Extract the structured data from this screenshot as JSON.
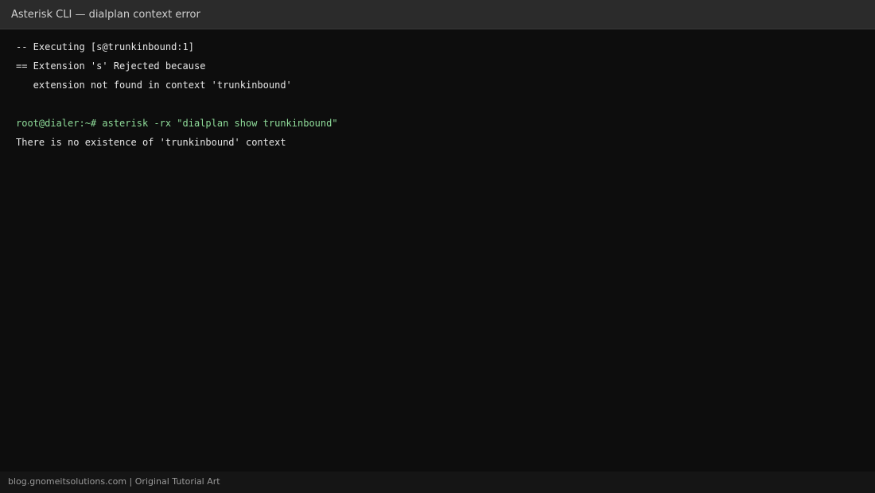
{
  "window": {
    "title": "Asterisk CLI — dialplan context error"
  },
  "terminal": {
    "lines": [
      "-- Executing [s@trunkinbound:1]",
      "== Extension 's' Rejected because",
      "   extension not found in context 'trunkinbound'",
      "",
      "root@dialer:~# asterisk -rx \"dialplan show trunkinbound\"",
      "There is no existence of 'trunkinbound' context"
    ]
  },
  "footer": {
    "text": "blog.gnomeitsolutions.com | Original Tutorial Art"
  },
  "colors": {
    "background": "#0d0d0d",
    "titlebar": "#2b2b2b",
    "text": "#e6e6e6",
    "prompt": "#8fdc9a"
  }
}
